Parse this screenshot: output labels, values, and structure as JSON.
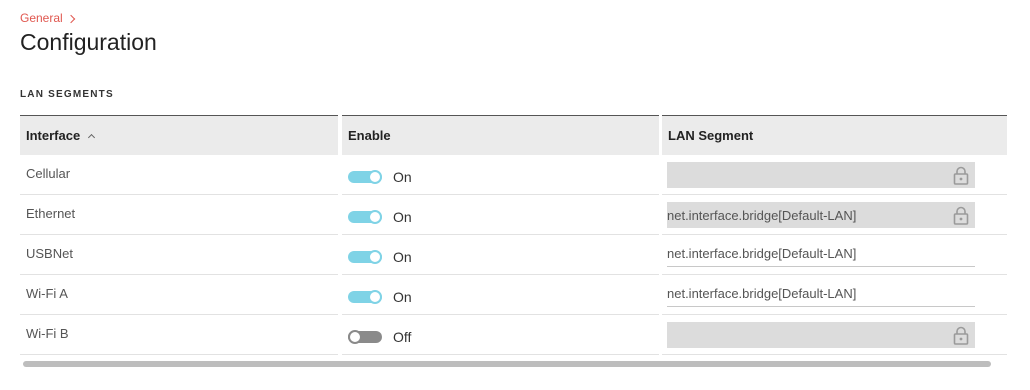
{
  "breadcrumb": {
    "parent": "General"
  },
  "page": {
    "title": "Configuration"
  },
  "section": {
    "title": "LAN SEGMENTS"
  },
  "table": {
    "columns": [
      "Interface",
      "Enable",
      "LAN Segment"
    ],
    "sort": {
      "column": "Interface",
      "direction": "ascending"
    },
    "rows": [
      {
        "interface": "Cellular",
        "enabled": true,
        "enable_label": "On",
        "segment": "",
        "locked": true
      },
      {
        "interface": "Ethernet",
        "enabled": true,
        "enable_label": "On",
        "segment": "net.interface.bridge[Default-LAN]",
        "locked": true
      },
      {
        "interface": "USBNet",
        "enabled": true,
        "enable_label": "On",
        "segment": "net.interface.bridge[Default-LAN]",
        "locked": false
      },
      {
        "interface": "Wi-Fi A",
        "enabled": true,
        "enable_label": "On",
        "segment": "net.interface.bridge[Default-LAN]",
        "locked": false
      },
      {
        "interface": "Wi-Fi B",
        "enabled": false,
        "enable_label": "Off",
        "segment": "",
        "locked": true
      }
    ]
  },
  "colors": {
    "accent": "#e0574f",
    "toggle_on": "#7fd3e6",
    "toggle_off": "#8a8a8a",
    "locked_field": "#dcdcdc"
  },
  "icons": {
    "breadcrumb_separator": "chevron-right-icon",
    "sort": "chevron-up-icon",
    "lock": "lock-icon"
  }
}
